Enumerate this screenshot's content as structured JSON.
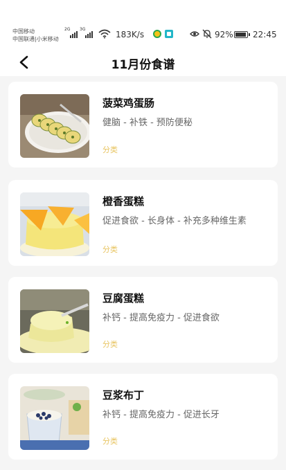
{
  "status_bar": {
    "carrier_1": "中国移动",
    "carrier_2": "中国联通|小米移动",
    "signal_1_tag": "2G",
    "signal_2_tag": "3G",
    "net_speed": "183K/s",
    "battery_percent": "92%",
    "time": "22:45"
  },
  "header": {
    "title": "11月份食谱"
  },
  "recipes": [
    {
      "name": "菠菜鸡蛋肠",
      "benefits": "健脑 - 补铁 - 预防便秘",
      "category_label": "分类",
      "image_icon": "spinach-egg-roll-photo"
    },
    {
      "name": "橙香蛋糕",
      "benefits": "促进食欲 - 长身体 - 补充多种维生素",
      "category_label": "分类",
      "image_icon": "orange-cake-photo"
    },
    {
      "name": "豆腐蛋糕",
      "benefits": "补钙 - 提高免疫力 - 促进食欲",
      "category_label": "分类",
      "image_icon": "tofu-cake-photo"
    },
    {
      "name": "豆浆布丁",
      "benefits": "补钙 - 提高免疫力 - 促进长牙",
      "category_label": "分类",
      "image_icon": "soymilk-pudding-photo"
    }
  ],
  "colors": {
    "background": "#f5f5f5",
    "card": "#ffffff",
    "category_accent": "#e8c460",
    "title": "#111111",
    "description": "#666666"
  }
}
